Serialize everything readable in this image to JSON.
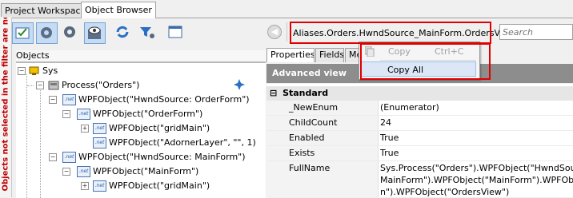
{
  "tabs": [
    {
      "label": "Project Workspace",
      "active": false
    },
    {
      "label": "Object Browser",
      "active": true
    }
  ],
  "filter_notice": "Objects not selected in the filter are not",
  "left_panel": {
    "header": "Objects",
    "tree": [
      {
        "label": "Sys",
        "icon": "computer-icon"
      },
      {
        "label": "Process(\"Orders\")",
        "icon": "process-icon"
      },
      {
        "label": "WPFObject(\"HwndSource: OrderForm\")",
        "icon": "net-icon"
      },
      {
        "label": "WPFObject(\"OrderForm\")",
        "icon": "net-icon"
      },
      {
        "label": "WPFObject(\"gridMain\")",
        "icon": "net-icon"
      },
      {
        "label": "WPFObject(\"AdornerLayer\", \"\", 1)",
        "icon": "net-icon"
      },
      {
        "label": "WPFObject(\"HwndSource: MainForm\")",
        "icon": "net-icon"
      },
      {
        "label": "WPFObject(\"MainForm\")",
        "icon": "net-icon"
      },
      {
        "label": "WPFObject(\"gridMain\")",
        "icon": "net-icon"
      }
    ],
    "net_icon_text": ".net"
  },
  "right_panel": {
    "path": "Aliases.Orders.HwndSource_MainForm.OrdersView",
    "search_placeholder": "Search",
    "tabs": [
      {
        "label": "Properties",
        "active": true
      },
      {
        "label": "Fields",
        "active": false
      },
      {
        "label": "Me",
        "active": false
      }
    ],
    "advanced_view_label": "Advanced view",
    "group": {
      "label": "Standard",
      "expander": "⊟"
    },
    "properties": [
      {
        "name": "_NewEnum",
        "value": "(Enumerator)"
      },
      {
        "name": "ChildCount",
        "value": "24"
      },
      {
        "name": "Enabled",
        "value": "True"
      },
      {
        "name": "Exists",
        "value": "True"
      },
      {
        "name": "FullName",
        "value_lines": [
          "Sys.Process(\"Orders\").WPFObject(\"HwndSource:",
          "MainForm\").WPFObject(\"MainForm\").WPFObject(\"g",
          "n\").WPFObject(\"OrdersView\")"
        ]
      }
    ]
  },
  "context_menu": {
    "items": [
      {
        "label": "Copy",
        "shortcut": "Ctrl+C",
        "enabled": false
      },
      {
        "label": "Copy All",
        "shortcut": "",
        "enabled": true,
        "highlighted": true
      }
    ]
  },
  "colors": {
    "callout": "#e00000",
    "filter_text": "#c00000",
    "advanced_header": "#8d8d8d"
  }
}
